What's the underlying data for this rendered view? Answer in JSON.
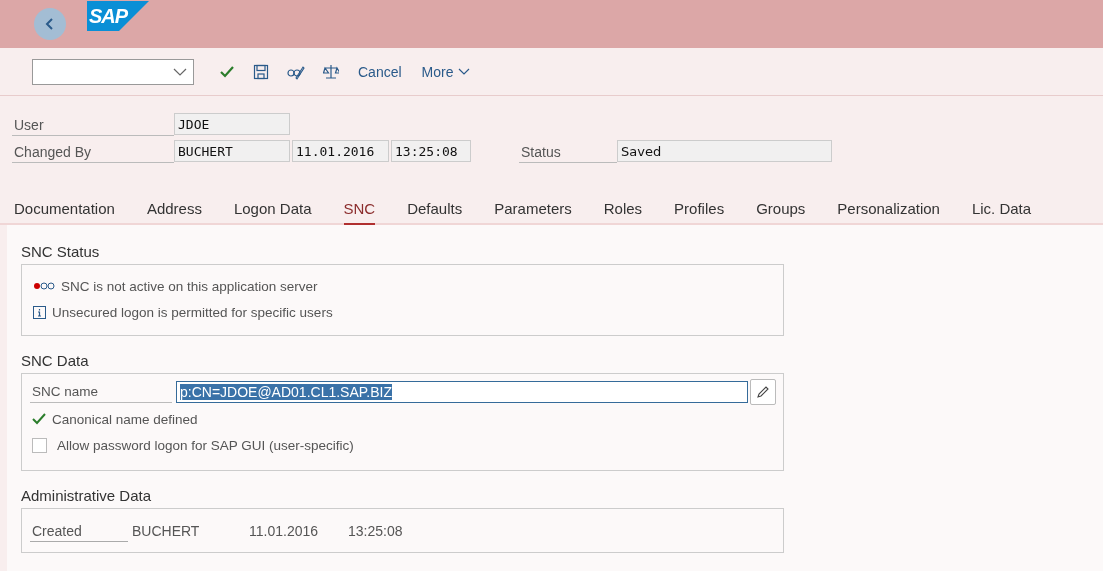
{
  "shell": {
    "logo": "SAP"
  },
  "toolbar": {
    "dropdown": {
      "kind": "empty"
    },
    "buttons": [
      {
        "kind": "check"
      },
      {
        "kind": "save"
      },
      {
        "kind": "glasses"
      },
      {
        "kind": "scale"
      },
      {
        "kind": "text",
        "label": "Cancel"
      },
      {
        "kind": "menu",
        "label": "More"
      }
    ]
  },
  "header": {
    "user": {
      "label": "User",
      "value": "JDOE"
    },
    "changed_by": {
      "label": "Changed By",
      "values": [
        "BUCHERT",
        "11.01.2016",
        "13:25:08"
      ]
    },
    "status": {
      "label": "Status",
      "value": "Saved"
    }
  },
  "tabs": [
    {
      "label": "Documentation",
      "selected": false
    },
    {
      "label": "Address",
      "selected": false
    },
    {
      "label": "Logon Data",
      "selected": false
    },
    {
      "label": "SNC",
      "selected": true
    },
    {
      "label": "Defaults",
      "selected": false
    },
    {
      "label": "Parameters",
      "selected": false
    },
    {
      "label": "Roles",
      "selected": false
    },
    {
      "label": "Profiles",
      "selected": false
    },
    {
      "label": "Groups",
      "selected": false
    },
    {
      "label": "Personalization",
      "selected": false
    },
    {
      "label": "Lic. Data",
      "selected": false
    }
  ],
  "snc_status": {
    "title": "SNC Status",
    "messages": [
      {
        "kind": "traffic",
        "text": "SNC is not active on this application server"
      },
      {
        "kind": "info",
        "text": "Unsecured logon is permitted for specific users"
      }
    ]
  },
  "snc_data": {
    "title": "SNC Data",
    "snc_name": {
      "label": "SNC name",
      "value": "p:CN=JDOE@AD01.CL1.SAP.BIZ",
      "selected": true
    },
    "canonical": {
      "text": "Canonical name defined"
    },
    "allow_password": {
      "label": "Allow password logon for SAP GUI (user-specific)",
      "checked": false
    }
  },
  "admin": {
    "title": "Administrative Data",
    "label": "Created",
    "values": [
      "BUCHERT",
      "11.01.2016",
      "13:25:08"
    ]
  }
}
